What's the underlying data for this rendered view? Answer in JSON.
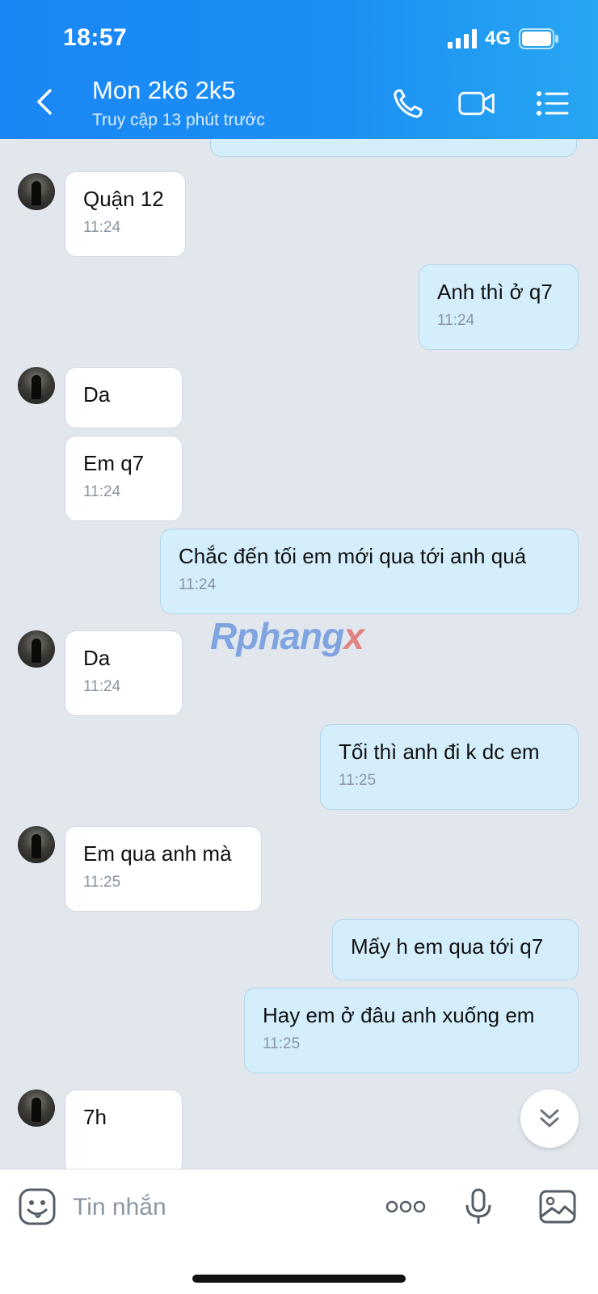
{
  "status_bar": {
    "time": "18:57",
    "network": "4G"
  },
  "header": {
    "title": "Mon 2k6 2k5",
    "subtitle": "Truy cập 13 phút trước"
  },
  "messages": [
    {
      "sender": "contact",
      "text": "Quận 12",
      "time": "11:24"
    },
    {
      "sender": "me",
      "text": "Anh thì ở q7",
      "time": "11:24"
    },
    {
      "sender": "contact",
      "text": "Da",
      "time": ""
    },
    {
      "sender": "contact",
      "text": "Em q7",
      "time": "11:24"
    },
    {
      "sender": "me",
      "text": "Chắc đến tối em mới qua tới anh quá",
      "time": "11:24"
    },
    {
      "sender": "contact",
      "text": "Da",
      "time": "11:24"
    },
    {
      "sender": "me",
      "text": "Tối thì anh đi k dc em",
      "time": "11:25"
    },
    {
      "sender": "contact",
      "text": "Em qua anh mà",
      "time": "11:25"
    },
    {
      "sender": "me",
      "text": "Mấy h em qua tới q7",
      "time": ""
    },
    {
      "sender": "me",
      "text": "Hay em ở đâu anh xuống em",
      "time": "11:25"
    },
    {
      "sender": "contact",
      "text": "7h",
      "time": ""
    }
  ],
  "watermark": {
    "main": "Rphang",
    "accent": "x"
  },
  "composer": {
    "placeholder": "Tin nhắn"
  },
  "icons": {
    "back": "chevron-left-icon",
    "call": "phone-icon",
    "video": "video-camera-icon",
    "menu": "list-menu-icon",
    "emoji": "sticker-emoji-icon",
    "more": "more-dots-icon",
    "mic": "microphone-icon",
    "image": "image-gallery-icon",
    "scroll": "double-chevron-down-icon"
  },
  "colors": {
    "header": "#1a86f5",
    "incoming_bubble": "#ffffff",
    "outgoing_bubble": "#d4eefb",
    "chat_background": "#e2e7ee"
  }
}
